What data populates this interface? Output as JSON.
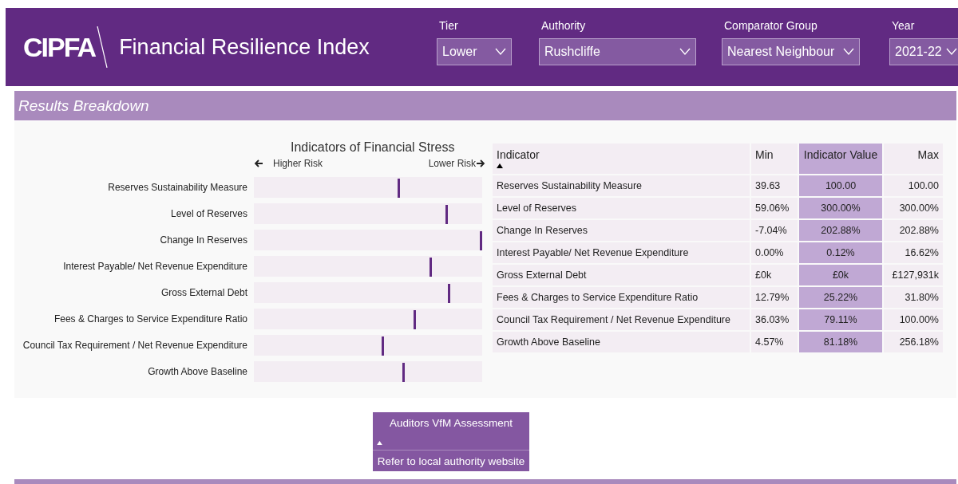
{
  "header": {
    "logo": "CIPFA",
    "title": "Financial Resilience Index",
    "filters": [
      {
        "label": "Tier",
        "value": "Lower"
      },
      {
        "label": "Authority",
        "value": "Rushcliffe"
      },
      {
        "label": "Comparator Group",
        "value": "Nearest Neighbour"
      },
      {
        "label": "Year",
        "value": "2021-22"
      }
    ]
  },
  "section_title": "Results Breakdown",
  "stress_chart": {
    "title": "Indicators of Financial Stress",
    "left_label": "Higher Risk",
    "right_label": "Lower Risk",
    "rows": [
      {
        "label": "Reserves Sustainability Measure",
        "level": 0.64
      },
      {
        "label": "Level of Reserves",
        "level": 0.85
      },
      {
        "label": "Change In Reserves",
        "level": 1.0
      },
      {
        "label": "Interest Payable/ Net Revenue Expenditure",
        "level": 0.78
      },
      {
        "label": "Gross External Debt",
        "level": 0.86
      },
      {
        "label": "Fees & Charges to Service Expenditure Ratio",
        "level": 0.71
      },
      {
        "label": "Council Tax Requirement / Net Revenue Expenditure",
        "level": 0.57
      },
      {
        "label": "Growth Above Baseline",
        "level": 0.66
      }
    ]
  },
  "table": {
    "columns": [
      "Indicator",
      "Min",
      "Indicator Value",
      "Max"
    ],
    "rows": [
      [
        "Reserves Sustainability Measure",
        "39.63",
        "100.00",
        "100.00"
      ],
      [
        "Level of Reserves",
        "59.06%",
        "300.00%",
        "300.00%"
      ],
      [
        "Change In Reserves",
        "-7.04%",
        "202.88%",
        "202.88%"
      ],
      [
        "Interest Payable/ Net Revenue Expenditure",
        "0.00%",
        "0.12%",
        "16.62%"
      ],
      [
        "Gross External Debt",
        "£0k",
        "£0k",
        "£127,931k"
      ],
      [
        "Fees & Charges to Service Expenditure Ratio",
        "12.79%",
        "25.22%",
        "31.80%"
      ],
      [
        "Council Tax Requirement / Net Revenue Expenditure",
        "36.03%",
        "79.11%",
        "100.00%"
      ],
      [
        "Growth Above Baseline",
        "4.57%",
        "81.18%",
        "256.18%"
      ]
    ]
  },
  "auditors": {
    "title": "Auditors VfM Assessment",
    "value": "Refer to local authority website"
  }
}
